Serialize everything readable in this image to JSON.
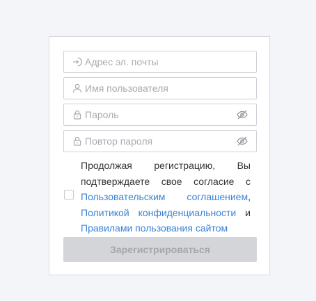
{
  "form": {
    "email": {
      "placeholder": "Адрес эл. почты",
      "value": "",
      "icon": "login-icon"
    },
    "username": {
      "placeholder": "Имя пользователя",
      "value": "",
      "icon": "user-icon"
    },
    "password": {
      "placeholder": "Пароль",
      "value": "",
      "icon": "lock-icon",
      "toggle_icon": "eye-off-icon"
    },
    "password_repeat": {
      "placeholder": "Повтор пароля",
      "value": "",
      "icon": "lock-icon",
      "toggle_icon": "eye-off-icon"
    },
    "consent": {
      "checked": false,
      "text_before": "Продолжая регистрацию, Вы подтверждаете свое согласие с",
      "link_user_agreement": "Пользовательским соглашением",
      "sep_comma": ",",
      "link_privacy_policy": "Политикой конфиденциальности",
      "sep_and": "и",
      "link_site_rules": "Правилами пользования сайтом"
    },
    "submit_label": "Зарегистрироваться"
  },
  "colors": {
    "background": "#f4f5f9",
    "link": "#3b82d6",
    "button_disabled_bg": "#d4d5d8",
    "button_disabled_text": "#a6a7ab",
    "placeholder": "#a9abb1"
  }
}
